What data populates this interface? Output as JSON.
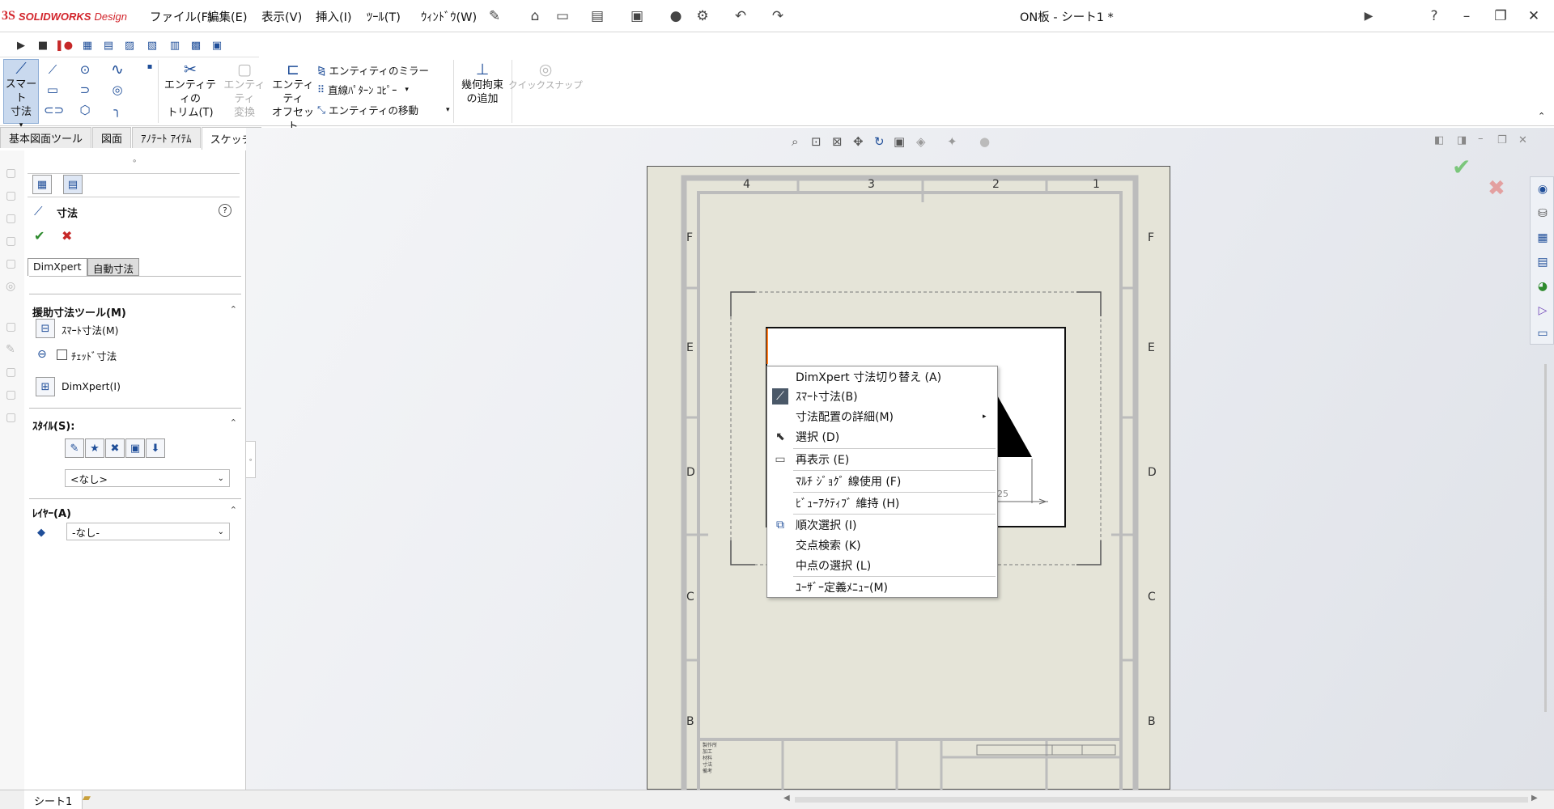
{
  "app": {
    "logo_mark": "3S",
    "brand": "SOLIDWORKS",
    "brand_suffix": "Design",
    "document_title": "ON板 - シート1 *"
  },
  "menu": [
    "ファイル(F)",
    "編集(E)",
    "表示(V)",
    "挿入(I)",
    "ﾂｰﾙ(T)",
    "ｳｨﾝﾄﾞｳ(W)"
  ],
  "ribbon": {
    "smart_dimension": "スマート\n寸法",
    "trim": "エンティティの\nトリム(T)",
    "convert": "エンティティ\n変換",
    "offset": "エンティティ\nオフセット",
    "mirror": "エンティティのミラー",
    "linear_pattern": "直線ﾊﾟﾀｰﾝ ｺﾋﾟｰ",
    "move": "エンティティの移動",
    "add_relation": "幾何拘束\nの追加",
    "quick_snap": "クイックスナップ"
  },
  "tabs": [
    "基本図面ツール",
    "図面",
    "ｱﾉﾃｰﾄ ｱｲﾃﾑ",
    "スケッチ"
  ],
  "panel": {
    "title": "寸法",
    "tab_dimxpert": "DimXpert",
    "tab_auto": "自動寸法",
    "section_tools": "援助寸法ツール(M)",
    "smart_dim": "ｽﾏｰﾄ寸法(M)",
    "chained": "ﾁｪｯﾄﾞ寸法",
    "dimxpert_item": "DimXpert(I)",
    "section_style": "ｽﾀｲﾙ(S):",
    "style_value": "<なし>",
    "section_layer": "ﾚｲﾔｰ(A)",
    "layer_value": "-なし-"
  },
  "sheet": {
    "cols": [
      "4",
      "3",
      "2",
      "1"
    ],
    "rows": [
      "F",
      "E",
      "D",
      "C",
      "B"
    ],
    "dim_value": "25",
    "titleblock": [
      "製作所",
      "加工",
      "材料",
      "寸法",
      "備考"
    ]
  },
  "context_menu": [
    {
      "label": "DimXpert 寸法切り替え (A)"
    },
    {
      "label": "ｽﾏｰﾄ寸法(B)"
    },
    {
      "label": "寸法配置の詳細(M)"
    },
    {
      "label": "選択 (D)"
    },
    {
      "label": "再表示 (E)"
    },
    {
      "label": "ﾏﾙﾁ ｼﾞｮｸﾞ 線使用 (F)"
    },
    {
      "label": "ﾋﾞｭｰｱｸﾃｨﾌﾞ 維持 (H)"
    },
    {
      "label": "順次選択 (I)"
    },
    {
      "label": "交点検索 (K)"
    },
    {
      "label": "中点の選択 (L)"
    },
    {
      "label": "ﾕｰｻﾞｰ定義ﾒﾆｭｰ(M)"
    }
  ],
  "bottom": {
    "sheet_tab": "シート1"
  },
  "colors": {
    "accent": "#1f4e99",
    "brand": "#d2232a",
    "ok": "#2e8b2e",
    "cancel": "#c62828",
    "sheet": "#e5e4d8"
  }
}
